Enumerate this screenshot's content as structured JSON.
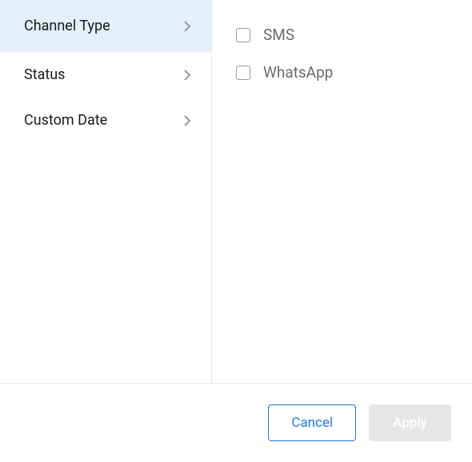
{
  "sidebar": {
    "items": [
      {
        "label": "Channel Type",
        "selected": true
      },
      {
        "label": "Status",
        "selected": false
      },
      {
        "label": "Custom Date",
        "selected": false
      }
    ]
  },
  "main": {
    "options": [
      {
        "label": "SMS",
        "checked": false
      },
      {
        "label": "WhatsApp",
        "checked": false
      }
    ]
  },
  "footer": {
    "cancel_label": "Cancel",
    "apply_label": "Apply"
  }
}
